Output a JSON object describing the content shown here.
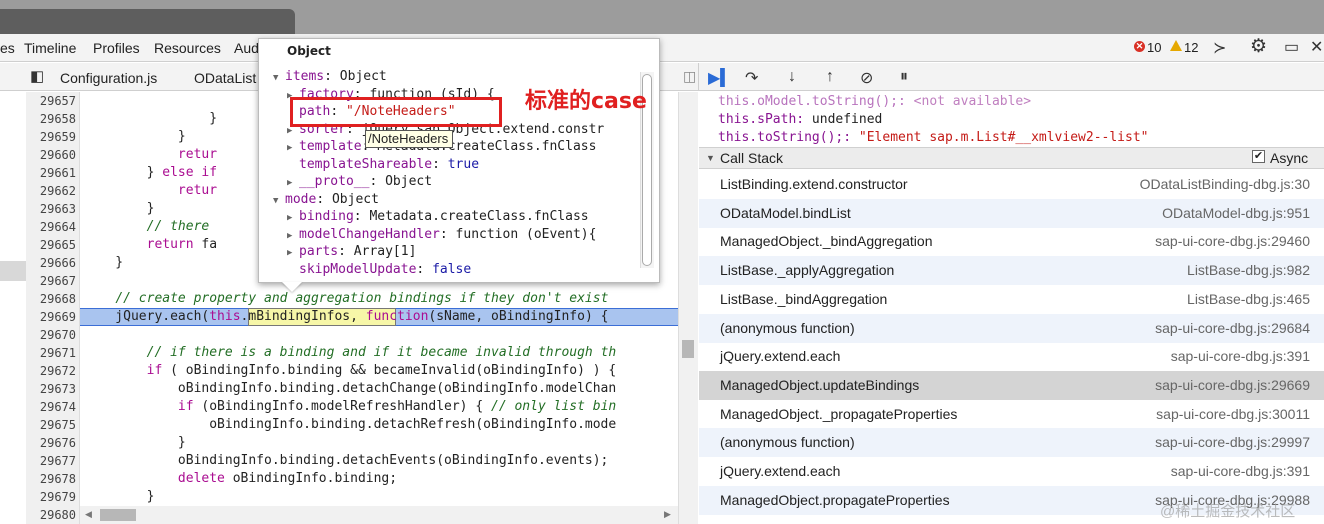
{
  "nav": {
    "tabs": [
      "es",
      "Timeline",
      "Profiles",
      "Resources",
      "Aud"
    ],
    "errors": "10",
    "warnings": "12"
  },
  "files": {
    "tabs": [
      "Configuration.js",
      "ODataList"
    ]
  },
  "code": {
    "lines": [
      {
        "n": "29657",
        "t": ""
      },
      {
        "n": "29658",
        "t": "                }"
      },
      {
        "n": "29659",
        "t": "            }"
      },
      {
        "n": "29660",
        "t": "            retur"
      },
      {
        "n": "29661",
        "t": "        } else if"
      },
      {
        "n": "29662",
        "t": "            retur"
      },
      {
        "n": "29663",
        "t": "        }"
      },
      {
        "n": "29664",
        "t": "        // there"
      },
      {
        "n": "29665",
        "t": "        return fa"
      },
      {
        "n": "29666",
        "t": "    }"
      },
      {
        "n": "29667",
        "t": ""
      },
      {
        "n": "29668",
        "t": "    // create property and aggregation bindings if they don't exist"
      },
      {
        "n": "29669",
        "t": "    jQuery.each(this.mBindingInfos, function(sName, oBindingInfo) {"
      },
      {
        "n": "29670",
        "t": ""
      },
      {
        "n": "29671",
        "t": "        // if there is a binding and if it became invalid through th"
      },
      {
        "n": "29672",
        "t": "        if ( oBindingInfo.binding && becameInvalid(oBindingInfo) ) {"
      },
      {
        "n": "29673",
        "t": "            oBindingInfo.binding.detachChange(oBindingInfo.modelChan"
      },
      {
        "n": "29674",
        "t": "            if (oBindingInfo.modelRefreshHandler) { // only list bin"
      },
      {
        "n": "29675",
        "t": "                oBindingInfo.binding.detachRefresh(oBindingInfo.mode"
      },
      {
        "n": "29676",
        "t": "            }"
      },
      {
        "n": "29677",
        "t": "            oBindingInfo.binding.detachEvents(oBindingInfo.events);"
      },
      {
        "n": "29678",
        "t": "            delete oBindingInfo.binding;"
      },
      {
        "n": "29679",
        "t": "        }"
      },
      {
        "n": "29680",
        "t": ""
      }
    ]
  },
  "popup": {
    "title": "Object",
    "rows": [
      {
        "k": "items",
        "v": "Object",
        "tri": "▼",
        "ind": 0
      },
      {
        "k": "factory",
        "v": "function (sId) {",
        "tri": "▶",
        "ind": 1
      },
      {
        "k": "path",
        "v": "\"/NoteHeaders\"",
        "tri": "",
        "ind": 1,
        "str": true
      },
      {
        "k": "sorter",
        "v": "jQuery.sap.Object.extend.constr",
        "tri": "▶",
        "ind": 1
      },
      {
        "k": "template",
        "v": "Metadata.createClass.fnClass",
        "tri": "▶",
        "ind": 1
      },
      {
        "k": "templateShareable",
        "v": "true",
        "tri": "",
        "ind": 1,
        "num": true
      },
      {
        "k": "__proto__",
        "v": "Object",
        "tri": "▶",
        "ind": 1
      },
      {
        "k": "mode",
        "v": "Object",
        "tri": "▼",
        "ind": 0
      },
      {
        "k": "binding",
        "v": "Metadata.createClass.fnClass",
        "tri": "▶",
        "ind": 1
      },
      {
        "k": "modelChangeHandler",
        "v": "function (oEvent){",
        "tri": "▶",
        "ind": 1
      },
      {
        "k": "parts",
        "v": "Array[1]",
        "tri": "▶",
        "ind": 1
      },
      {
        "k": "skipModelUpdate",
        "v": "false",
        "tri": "",
        "ind": 1,
        "num": true
      }
    ],
    "tooltip": "/NoteHeaders"
  },
  "annotation": "标准的case",
  "watch": [
    {
      "k": "this.oModel.toString();:",
      "v": "<not available>",
      "dim": true
    },
    {
      "k": "this.sPath:",
      "v": "undefined",
      "dim": false
    },
    {
      "k": "this.toString();:",
      "v": "\"Element sap.m.List#__xmlview2--list\"",
      "dim": false,
      "str": true
    }
  ],
  "callstack": {
    "title": "Call Stack",
    "async_label": "Async",
    "frames": [
      {
        "name": "ListBinding.extend.constructor",
        "loc": "ODataListBinding-dbg.js:30"
      },
      {
        "name": "ODataModel.bindList",
        "loc": "ODataModel-dbg.js:951"
      },
      {
        "name": "ManagedObject._bindAggregation",
        "loc": "sap-ui-core-dbg.js:29460"
      },
      {
        "name": "ListBase._applyAggregation",
        "loc": "ListBase-dbg.js:982"
      },
      {
        "name": "ListBase._bindAggregation",
        "loc": "ListBase-dbg.js:465"
      },
      {
        "name": "(anonymous function)",
        "loc": "sap-ui-core-dbg.js:29684"
      },
      {
        "name": "jQuery.extend.each",
        "loc": "sap-ui-core-dbg.js:391"
      },
      {
        "name": "ManagedObject.updateBindings",
        "loc": "sap-ui-core-dbg.js:29669"
      },
      {
        "name": "ManagedObject._propagateProperties",
        "loc": "sap-ui-core-dbg.js:30011"
      },
      {
        "name": "(anonymous function)",
        "loc": "sap-ui-core-dbg.js:29997"
      },
      {
        "name": "jQuery.extend.each",
        "loc": "sap-ui-core-dbg.js:391"
      },
      {
        "name": "ManagedObject.propagateProperties",
        "loc": "sap-ui-core-dbg.js:29988"
      }
    ]
  },
  "watermark": "@稀土掘金技术社区"
}
